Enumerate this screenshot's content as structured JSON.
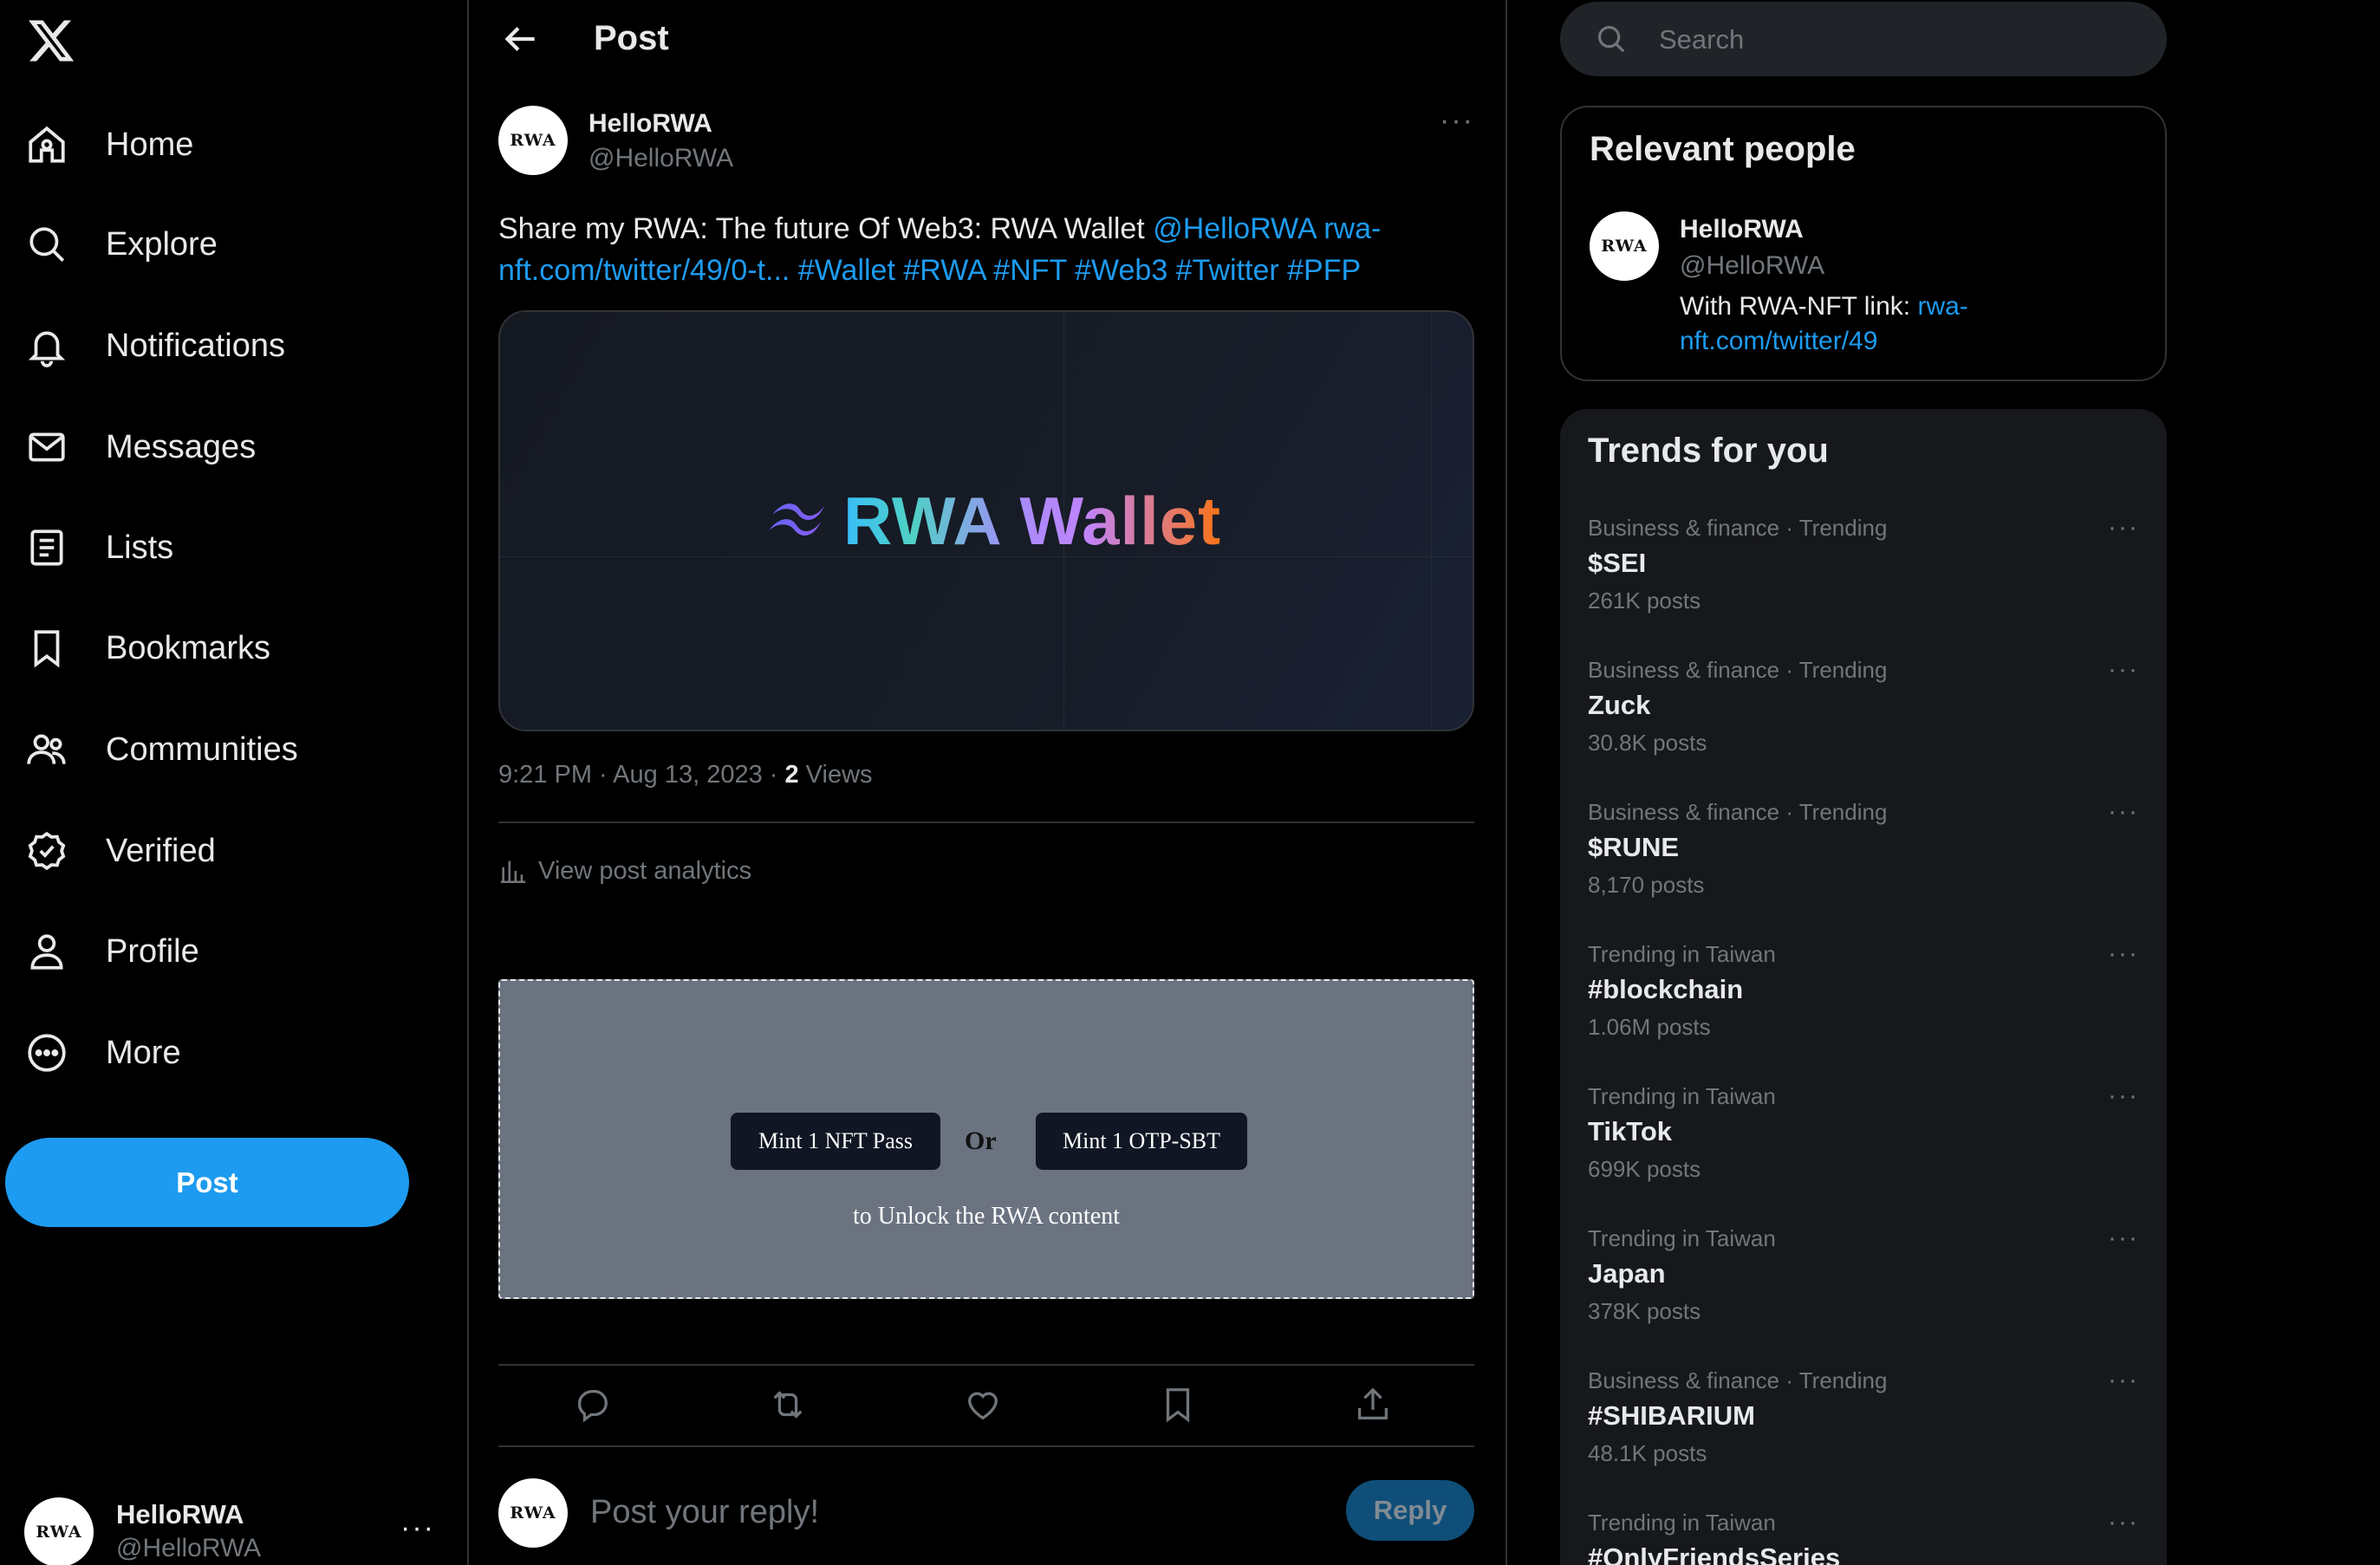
{
  "nav": {
    "items": [
      {
        "label": "Home",
        "icon": "home-icon"
      },
      {
        "label": "Explore",
        "icon": "search-icon"
      },
      {
        "label": "Notifications",
        "icon": "bell-icon"
      },
      {
        "label": "Messages",
        "icon": "mail-icon"
      },
      {
        "label": "Lists",
        "icon": "list-icon"
      },
      {
        "label": "Bookmarks",
        "icon": "bookmark-icon"
      },
      {
        "label": "Communities",
        "icon": "people-icon"
      },
      {
        "label": "Verified",
        "icon": "verified-icon"
      },
      {
        "label": "Profile",
        "icon": "person-icon"
      },
      {
        "label": "More",
        "icon": "more-circle-icon"
      }
    ],
    "post_button": "Post"
  },
  "account": {
    "avatar_text": "RWA",
    "name": "HelloRWA",
    "handle": "@HelloRWA",
    "more": "···"
  },
  "header": {
    "title": "Post"
  },
  "post": {
    "avatar_text": "RWA",
    "author": "HelloRWA",
    "handle": "@HelloRWA",
    "more": "···",
    "text_plain": "Share my RWA: The future Of Web3: RWA Wallet ",
    "text_mention": "@HelloRWA",
    "text_link_a": "rwa-",
    "text_link_b": "nft.com/twitter/49/0-t...",
    "text_hashtags": "#Wallet #RWA #NFT #Web3 #Twitter #PFP",
    "media_text": "RWA Wallet",
    "time": "9:21 PM · Aug 13, 2023 · ",
    "views_count": "2",
    "views_label": " Views",
    "analytics_label": "View post analytics",
    "gate": {
      "button_nft": "Mint 1 NFT Pass",
      "or": "Or",
      "button_sbt": "Mint 1 OTP-SBT",
      "unlock": "to Unlock the RWA content"
    }
  },
  "reply": {
    "avatar_text": "RWA",
    "placeholder": "Post your reply!",
    "button": "Reply"
  },
  "search": {
    "placeholder": "Search"
  },
  "relevant": {
    "title": "Relevant people",
    "avatar_text": "RWA",
    "name": "HelloRWA",
    "handle": "@HelloRWA",
    "bio_text": "With RWA-NFT link: ",
    "bio_link": "rwa-nft.com/twitter/49"
  },
  "trends": {
    "title": "Trends for you",
    "more": "···",
    "items": [
      {
        "category": "Business & finance · Trending",
        "name": "$SEI",
        "count": "261K posts"
      },
      {
        "category": "Business & finance · Trending",
        "name": "Zuck",
        "count": "30.8K posts"
      },
      {
        "category": "Business & finance · Trending",
        "name": "$RUNE",
        "count": "8,170 posts"
      },
      {
        "category": "Trending in Taiwan",
        "name": "#blockchain",
        "count": "1.06M posts"
      },
      {
        "category": "Trending in Taiwan",
        "name": "TikTok",
        "count": "699K posts"
      },
      {
        "category": "Trending in Taiwan",
        "name": "Japan",
        "count": "378K posts"
      },
      {
        "category": "Business & finance · Trending",
        "name": "#SHIBARIUM",
        "count": "48.1K posts"
      },
      {
        "category": "Trending in Taiwan",
        "name": "#OnlyFriendsSeries",
        "count": ""
      }
    ]
  },
  "colors": {
    "accent": "#1d9bf0",
    "background": "#000000",
    "muted": "#71767b",
    "gate_bg": "#6b7280"
  }
}
